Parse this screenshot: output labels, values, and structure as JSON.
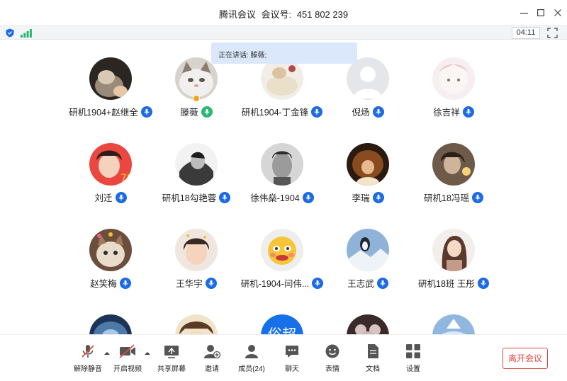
{
  "window": {
    "app_name": "腾讯会议",
    "meeting_id_label": "会议号:",
    "meeting_id": "451 802 239",
    "minimize": "—",
    "maximize": "☐",
    "close": "✕"
  },
  "status": {
    "timer": "04:11"
  },
  "speaking": {
    "text": "正在讲话: 滕薇;"
  },
  "participants": [
    {
      "name": "研机1904+赵继全",
      "mic": "blue"
    },
    {
      "name": "滕薇",
      "mic": "green"
    },
    {
      "name": "研机1904-丁金锋",
      "mic": "blue"
    },
    {
      "name": "倪炀",
      "mic": "blue"
    },
    {
      "name": "徐吉祥",
      "mic": "blue"
    },
    {
      "name": "刘迁",
      "mic": "blue"
    },
    {
      "name": "研机18勾艳蓉",
      "mic": "blue"
    },
    {
      "name": "徐伟燊-1904",
      "mic": "blue"
    },
    {
      "name": "李瑞",
      "mic": "blue"
    },
    {
      "name": "研机18冯瑶",
      "mic": "blue"
    },
    {
      "name": "赵笑梅",
      "mic": "blue"
    },
    {
      "name": "王华宇",
      "mic": "blue"
    },
    {
      "name": "研机-1904-闫伟...",
      "mic": "blue"
    },
    {
      "name": "王志武",
      "mic": "blue"
    },
    {
      "name": "研机18班 王彤",
      "mic": "blue"
    }
  ],
  "partial_row_text": "俗超",
  "toolbar": {
    "unmute": "解除静音",
    "start_video": "开启视频",
    "share_screen": "共享屏幕",
    "invite": "邀请",
    "members": "成员(24)",
    "chat": "聊天",
    "reactions": "表情",
    "docs": "文档",
    "settings": "设置",
    "leave": "离开会议"
  },
  "colors": {
    "accent": "#1c6ae4",
    "speaking_bg": "#dbe7fa",
    "leave": "#e0493f",
    "mic_green": "#2bb673"
  }
}
